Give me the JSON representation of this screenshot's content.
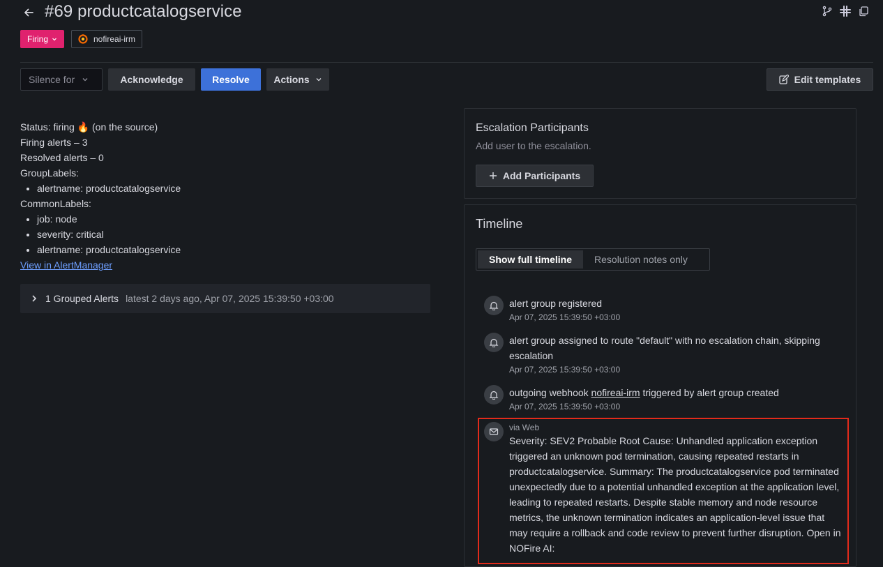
{
  "header": {
    "title": "#69 productcatalogservice",
    "status": "Firing",
    "integration": "nofireai-irm"
  },
  "toolbar": {
    "silence_placeholder": "Silence for",
    "acknowledge": "Acknowledge",
    "resolve": "Resolve",
    "actions": "Actions",
    "edit_templates": "Edit templates"
  },
  "alert": {
    "status_line": "Status: firing 🔥 (on the source)",
    "firing_alerts": "Firing alerts – 3",
    "resolved_alerts": "Resolved alerts – 0",
    "group_labels_title": "GroupLabels:",
    "group_labels": [
      "alertname: productcatalogservice"
    ],
    "common_labels_title": "CommonLabels:",
    "common_labels": [
      "job: node",
      "severity: critical",
      "alertname: productcatalogservice"
    ],
    "alertmanager_link": "View in AlertManager"
  },
  "grouped": {
    "title": "1 Grouped Alerts",
    "meta": "latest 2 days ago,  Apr 07, 2025 15:39:50 +03:00"
  },
  "escalation": {
    "title": "Escalation Participants",
    "subtitle": "Add user to the escalation.",
    "add_button": "Add Participants"
  },
  "timeline": {
    "title": "Timeline",
    "tabs": [
      "Show full timeline",
      "Resolution notes only"
    ],
    "items": [
      {
        "text": "alert group registered",
        "time": "Apr 07, 2025 15:39:50 +03:00"
      },
      {
        "text": "alert group assigned to route \"default\" with no escalation chain, skipping escalation",
        "time": "Apr 07, 2025 15:39:50 +03:00"
      },
      {
        "text_before": "outgoing webhook ",
        "link": "nofireai-irm",
        "text_after": " triggered by alert group created",
        "time": "Apr 07, 2025 15:39:50 +03:00"
      }
    ],
    "note": {
      "via": "via Web",
      "text": "Severity: SEV2 Probable Root Cause: Unhandled application exception triggered an unknown pod termination, causing repeated restarts in productcatalogservice. Summary: The productcatalogservice pod terminated unexpectedly due to a potential unhandled exception at the application level, leading to repeated restarts. Despite stable memory and node resource metrics, the unknown termination indicates an application-level issue that may require a rollback and code review to prevent further disruption. Open in NOFire AI:"
    }
  }
}
